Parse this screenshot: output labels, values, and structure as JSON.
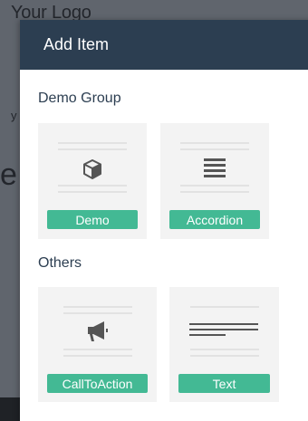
{
  "background": {
    "logo": "Your Logo",
    "fragment_small": "y",
    "fragment_large": "e"
  },
  "modal": {
    "title": "Add Item",
    "groups": [
      {
        "title": "Demo Group",
        "items": [
          {
            "label": "Demo",
            "icon": "cube-icon"
          },
          {
            "label": "Accordion",
            "icon": "accordion-icon"
          }
        ]
      },
      {
        "title": "Others",
        "items": [
          {
            "label": "CallToAction",
            "icon": "megaphone-icon"
          },
          {
            "label": "Text",
            "icon": "text-lines-icon"
          }
        ]
      }
    ]
  },
  "colors": {
    "header_bg": "#2c3e51",
    "button_bg": "#43b994",
    "card_bg": "#f3f3f3",
    "overlay_bg": "#60656d"
  }
}
